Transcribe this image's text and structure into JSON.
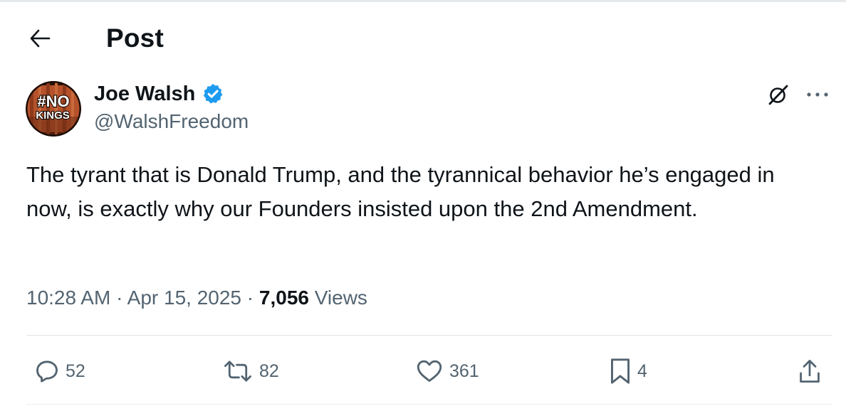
{
  "header": {
    "title": "Post",
    "back_icon": "arrow-left-icon"
  },
  "author": {
    "name": "Joe Walsh",
    "handle": "@WalshFreedom",
    "verified": true,
    "verified_color": "#1d9bf0",
    "avatar": {
      "line1": "#NO",
      "line2": "KINGS"
    }
  },
  "post": {
    "text": "The tyrant that is Donald Trump, and the tyrannical behavior he’s engaged in now, is exactly why our Founders insisted upon the 2nd Amendment.",
    "time": "10:28 AM",
    "date": "Apr 15, 2025",
    "separator": "·",
    "views_count": "7,056",
    "views_label": "Views"
  },
  "actions": {
    "replies": "52",
    "reposts": "82",
    "likes": "361",
    "bookmarks": "4"
  },
  "icons": {
    "grok": "grok-icon",
    "more": "more-icon",
    "reply": "reply-icon",
    "repost": "repost-icon",
    "like": "heart-icon",
    "bookmark": "bookmark-icon",
    "share": "share-icon"
  }
}
